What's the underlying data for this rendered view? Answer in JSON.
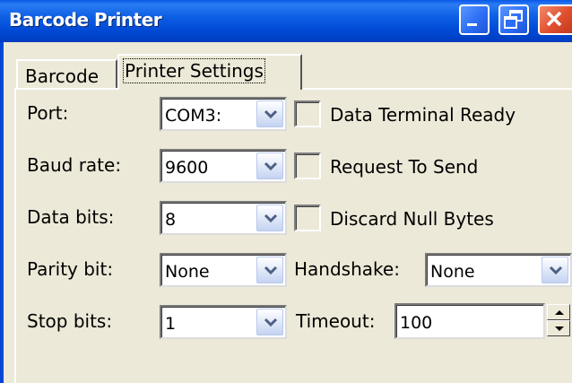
{
  "window": {
    "title": "Barcode Printer"
  },
  "titlebar_buttons": [
    {
      "name": "minimize-button",
      "icon": "minimize-icon"
    },
    {
      "name": "maximize-button",
      "icon": "maximize-icon"
    },
    {
      "name": "close-button",
      "icon": "close-icon"
    }
  ],
  "tabs": [
    {
      "label": "Barcode",
      "active": false
    },
    {
      "label": "Printer Settings",
      "active": true
    }
  ],
  "settings": {
    "port": {
      "label": "Port:",
      "value": "COM3:"
    },
    "baud_rate": {
      "label": "Baud rate:",
      "value": "9600"
    },
    "data_bits": {
      "label": "Data bits:",
      "value": "8"
    },
    "parity_bit": {
      "label": "Parity bit:",
      "value": "None"
    },
    "stop_bits": {
      "label": "Stop bits:",
      "value": "1"
    },
    "handshake": {
      "label": "Handshake:",
      "value": "None"
    },
    "timeout": {
      "label": "Timeout:",
      "value": "100"
    }
  },
  "checkboxes": {
    "data_terminal_ready": {
      "label": "Data Terminal Ready",
      "checked": false
    },
    "request_to_send": {
      "label": "Request To Send",
      "checked": false
    },
    "discard_null_bytes": {
      "label": "Discard Null Bytes",
      "checked": false
    }
  },
  "colors": {
    "titlebar": "#0048d4",
    "close_button": "#e0502f",
    "dropdown_arrow": "#4d6185",
    "face": "#ece9d8"
  }
}
